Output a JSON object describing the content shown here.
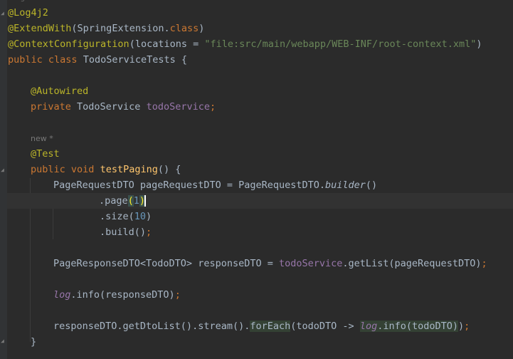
{
  "top_hint": "usages",
  "lines": {
    "l1": {
      "annotation": "@Log4j2"
    },
    "l2": {
      "annotation": "@ExtendWith",
      "open": "(",
      "cls": "SpringExtension",
      "dot": ".",
      "kw_class": "class",
      "close": ")"
    },
    "l3": {
      "annotation": "@ContextConfiguration",
      "open": "(locations = ",
      "str": "\"file:src/main/webapp/WEB-INF/root-context.xml\"",
      "close": ")"
    },
    "l4": {
      "kw1": "public",
      "kw2": "class",
      "name": " TodoServiceTests {"
    },
    "l6": {
      "annotation": "@Autowired"
    },
    "l7": {
      "kw": "private",
      "type": " TodoService ",
      "field": "todoService",
      "semi": ";"
    },
    "l9": {
      "hint": "new *"
    },
    "l10": {
      "annotation": "@Test"
    },
    "l11": {
      "kw1": "public",
      "kw2": "void",
      "method": "testPaging",
      "rest": "() {"
    },
    "l12": {
      "a": "PageRequestDTO pageRequestDTO = PageRequestDTO.",
      "b": "builder",
      "c": "()"
    },
    "l13": {
      "a": ".page",
      "open": "(",
      "num": "1",
      "close": ")"
    },
    "l14": {
      "a": ".size(",
      "num": "10",
      "close": ")"
    },
    "l15": {
      "a": ".build()",
      "semi": ";"
    },
    "l17": {
      "a": "PageResponseDTO<TodoDTO> responseDTO = ",
      "field": "todoService",
      "b": ".getList(pageRequestDTO)",
      "semi": ";"
    },
    "l19": {
      "log": "log",
      "a": ".info(responseDTO)",
      "semi": ";"
    },
    "l21": {
      "a": "responseDTO.getDtoList().stream()",
      "b": ".",
      "forEach": "forEach",
      "c": "(todoDTO -> ",
      "log": "log",
      "d": ".info(todoDTO)",
      "e": ")",
      "semi": ";"
    },
    "l22": {
      "a": "}"
    }
  }
}
